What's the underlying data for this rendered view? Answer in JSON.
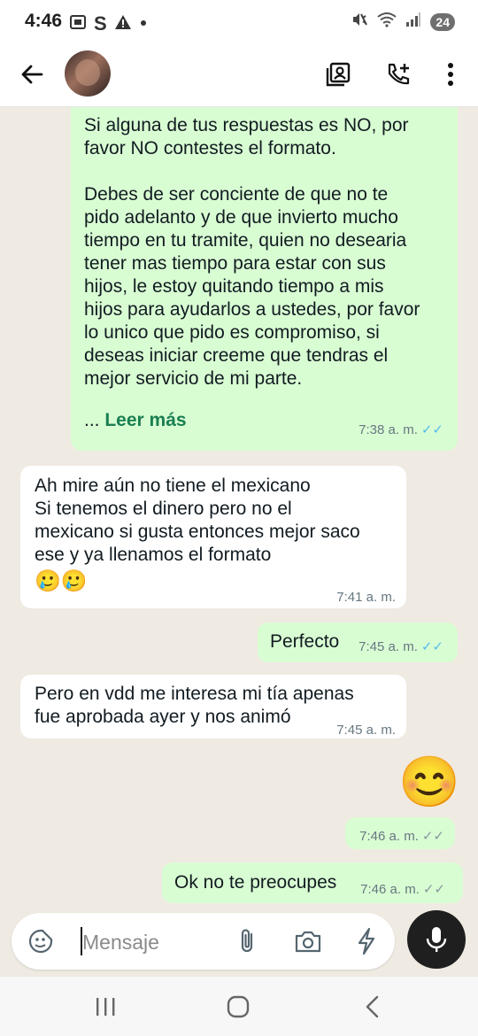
{
  "status_bar": {
    "time": "4:46",
    "battery": "24",
    "icons": [
      "screenshot-icon",
      "s-icon",
      "warning-icon",
      "dot-icon",
      "mute-icon",
      "wifi-icon",
      "signal-icon"
    ]
  },
  "header": {
    "icons": [
      "back-arrow-icon",
      "contact-card-icon",
      "add-call-icon",
      "more-vert-icon"
    ]
  },
  "messages": [
    {
      "direction": "out",
      "text_lines": [
        "Si alguna de tus respuestas es NO, por",
        "favor NO contestes el formato.",
        "",
        "Debes de ser conciente de que no te",
        "pido adelanto y de que invierto mucho",
        "tiempo en tu tramite, quien no desearia",
        "tener mas tiempo para estar con sus",
        "hijos, le estoy quitando tiempo a mis",
        "hijos para ayudarlos a ustedes, por favor",
        "lo unico que pido es compromiso, si",
        "deseas iniciar creeme que tendras el",
        "mejor servicio de mi parte."
      ],
      "read_more_prefix": "...",
      "read_more": "Leer más",
      "time": "7:38 a. m.",
      "ticks": "read"
    },
    {
      "direction": "in",
      "text_lines": [
        "Ah mire aún no tiene el mexicano",
        "Si tenemos el dinero pero no el",
        "mexicano si gusta entonces mejor saco",
        "ese y ya llenamos el formato"
      ],
      "emoji": "🥲🥲",
      "time": "7:41 a. m."
    },
    {
      "direction": "out",
      "text": "Perfecto",
      "time": "7:45 a. m.",
      "ticks": "read"
    },
    {
      "direction": "in",
      "text_lines": [
        "Pero en vdd me interesa mi tía apenas",
        "fue aprobada ayer y nos animó"
      ],
      "time": "7:45 a. m."
    },
    {
      "direction": "out",
      "emoji": "😊",
      "time": "7:46 a. m.",
      "ticks": "delivered"
    },
    {
      "direction": "out",
      "text": "Ok no te preocupes",
      "time": "7:46 a. m.",
      "ticks": "delivered"
    }
  ],
  "composer": {
    "placeholder": "Mensaje",
    "icons": [
      "sticker-icon",
      "attach-icon",
      "camera-icon",
      "lightning-icon",
      "mic-icon"
    ]
  },
  "nav_bar": {
    "icons": [
      "recents-icon",
      "home-icon",
      "back-icon"
    ]
  },
  "colors": {
    "outgoing_bubble": "#d9fdd3",
    "incoming_bubble": "#ffffff",
    "read_ticks": "#53bdeb",
    "read_more": "#1a7f52",
    "chat_background": "#efeae2"
  }
}
